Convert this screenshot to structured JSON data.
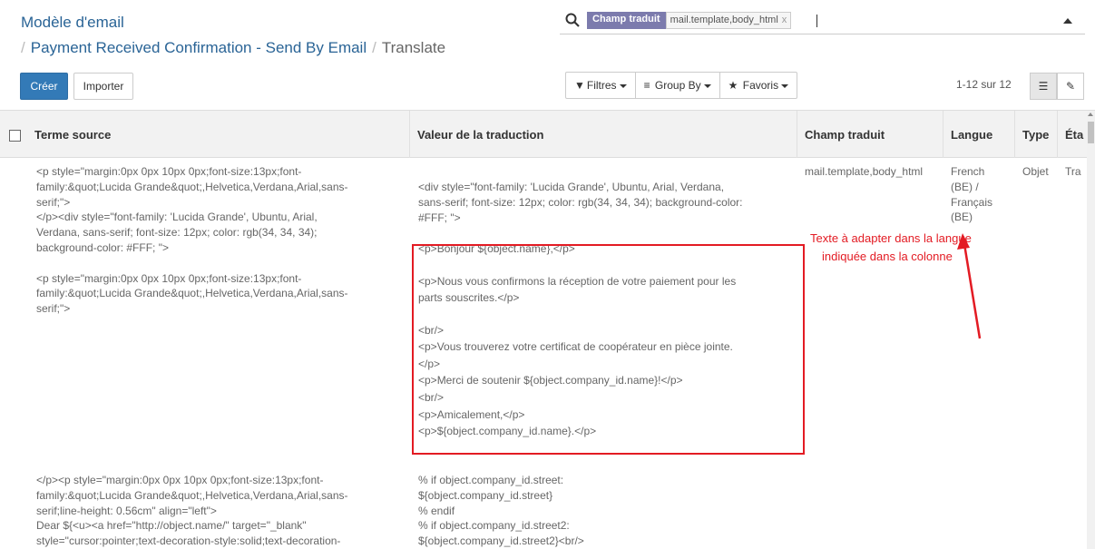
{
  "breadcrumb": {
    "root": "Modèle d'email",
    "record": "Payment Received Confirmation - Send By Email",
    "current": "Translate"
  },
  "search": {
    "facet_label": "Champ traduit",
    "facet_value": "mail.template,body_html",
    "facet_remove": "x"
  },
  "toolbar": {
    "create": "Créer",
    "import": "Importer",
    "filters": "Filtres",
    "group_by": "Group By",
    "favorites": "Favoris",
    "pager": "1-12 sur 12"
  },
  "columns": {
    "source": "Terme source",
    "value": "Valeur de la traduction",
    "field": "Champ traduit",
    "lang": "Langue",
    "type": "Type",
    "state": "Éta"
  },
  "row1": {
    "source_lines": [
      "<p style=\"margin:0px 0px 10px 0px;font-size:13px;font-",
      "family:&quot;Lucida Grande&quot;,Helvetica,Verdana,Arial,sans-",
      "serif;\">",
      "</p><div style=\"font-family: 'Lucida Grande', Ubuntu, Arial,",
      "Verdana, sans-serif; font-size: 12px; color: rgb(34, 34, 34);",
      "background-color: #FFF; \">",
      "",
      "<p style=\"margin:0px 0px 10px 0px;font-size:13px;font-",
      "family:&quot;Lucida Grande&quot;,Helvetica,Verdana,Arial,sans-",
      "serif;\">"
    ],
    "value_lines": [
      "<div style=\"font-family: 'Lucida Grande', Ubuntu, Arial, Verdana,",
      "sans-serif; font-size: 12px; color: rgb(34, 34, 34); background-color:",
      "#FFF; \">",
      "",
      "<p>Bonjour ${object.name},</p>",
      "",
      "<p>Nous vous confirmons la réception de votre paiement pour les",
      "parts souscrites.</p>",
      "",
      "<br/>",
      "<p>Vous trouverez votre certificat de coopérateur en pièce jointe.",
      "</p>",
      "<p>Merci de soutenir ${object.company_id.name}!</p>",
      "<br/>",
      "<p>Amicalement,</p>",
      "<p>${object.company_id.name}.</p>"
    ],
    "field": "mail.template,body_html",
    "lang_lines": [
      "French",
      "(BE) /",
      "Français",
      "(BE)"
    ],
    "type": "Objet",
    "state": "Tra"
  },
  "row2": {
    "source_lines": [
      "</p><p style=\"margin:0px 0px 10px 0px;font-size:13px;font-",
      "family:&quot;Lucida Grande&quot;,Helvetica,Verdana,Arial,sans-",
      "serif;line-height: 0.56cm\" align=\"left\">",
      "Dear ${<u><a href=\"http://object.name/\" target=\"_blank\"",
      "style=\"cursor:pointer;text-decoration-style:solid;text-decoration-"
    ],
    "value_lines": [
      "% if object.company_id.street:",
      "${object.company_id.street}",
      "% endif",
      "% if object.company_id.street2:",
      "${object.company_id.street2}<br/>"
    ]
  },
  "annotation": {
    "line1": "Texte à adapter dans la langue",
    "line2": "indiquée dans la colonne",
    "color": "#e31b23"
  }
}
